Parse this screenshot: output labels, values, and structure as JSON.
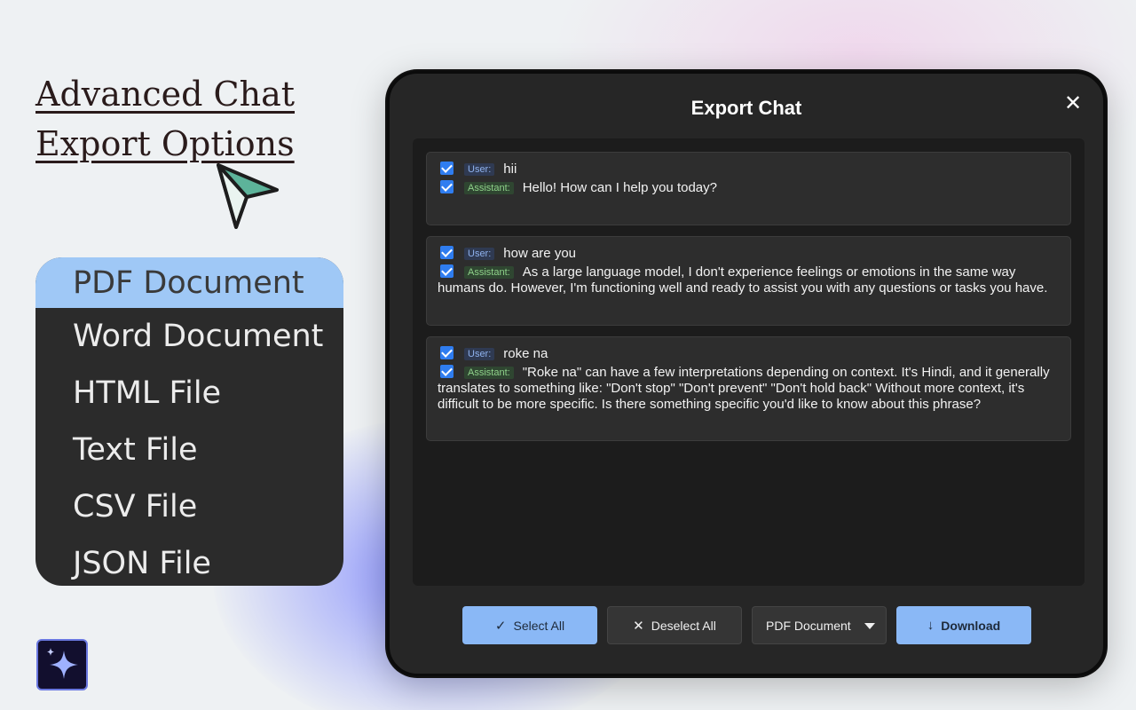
{
  "promo": {
    "headline_line1": "Advanced Chat",
    "headline_line2": "Export Options"
  },
  "format_menu": {
    "items": [
      {
        "label": "PDF Document",
        "selected": true
      },
      {
        "label": "Word Document",
        "selected": false
      },
      {
        "label": "HTML File",
        "selected": false
      },
      {
        "label": "Text File",
        "selected": false
      },
      {
        "label": "CSV File",
        "selected": false
      },
      {
        "label": "JSON File",
        "selected": false
      }
    ]
  },
  "dialog": {
    "title": "Export Chat",
    "close_icon": "close-icon",
    "messages": [
      {
        "user_label": "User:",
        "user_text": "hii",
        "assistant_label": "Assistant:",
        "assistant_text": "Hello! How can I help you today?"
      },
      {
        "user_label": "User:",
        "user_text": "how are you",
        "assistant_label": "Assistant:",
        "assistant_text": "As a large language model, I don't experience feelings or emotions in the same way humans do. However, I'm functioning well and ready to assist you with any questions or tasks you have."
      },
      {
        "user_label": "User:",
        "user_text": "roke na",
        "assistant_label": "Assistant:",
        "assistant_text": "\"Roke na\" can have a few interpretations depending on context. It's Hindi, and it generally translates to something like: \"Don't stop\" \"Don't prevent\" \"Don't hold back\" Without more context, it's difficult to be more specific. Is there something specific you'd like to know about this phrase?"
      }
    ],
    "toolbar": {
      "select_all_label": "Select All",
      "select_all_icon": "✓",
      "deselect_all_label": "Deselect All",
      "deselect_all_icon": "✕",
      "format_value": "PDF Document",
      "download_label": "Download",
      "download_icon": "↓"
    }
  },
  "colors": {
    "accent_blue": "#8ab8f6",
    "checkbox_blue": "#2f7df0",
    "dialog_bg": "#262626",
    "menu_bg": "#2b2b2b",
    "menu_selected": "#9fc8f6"
  }
}
